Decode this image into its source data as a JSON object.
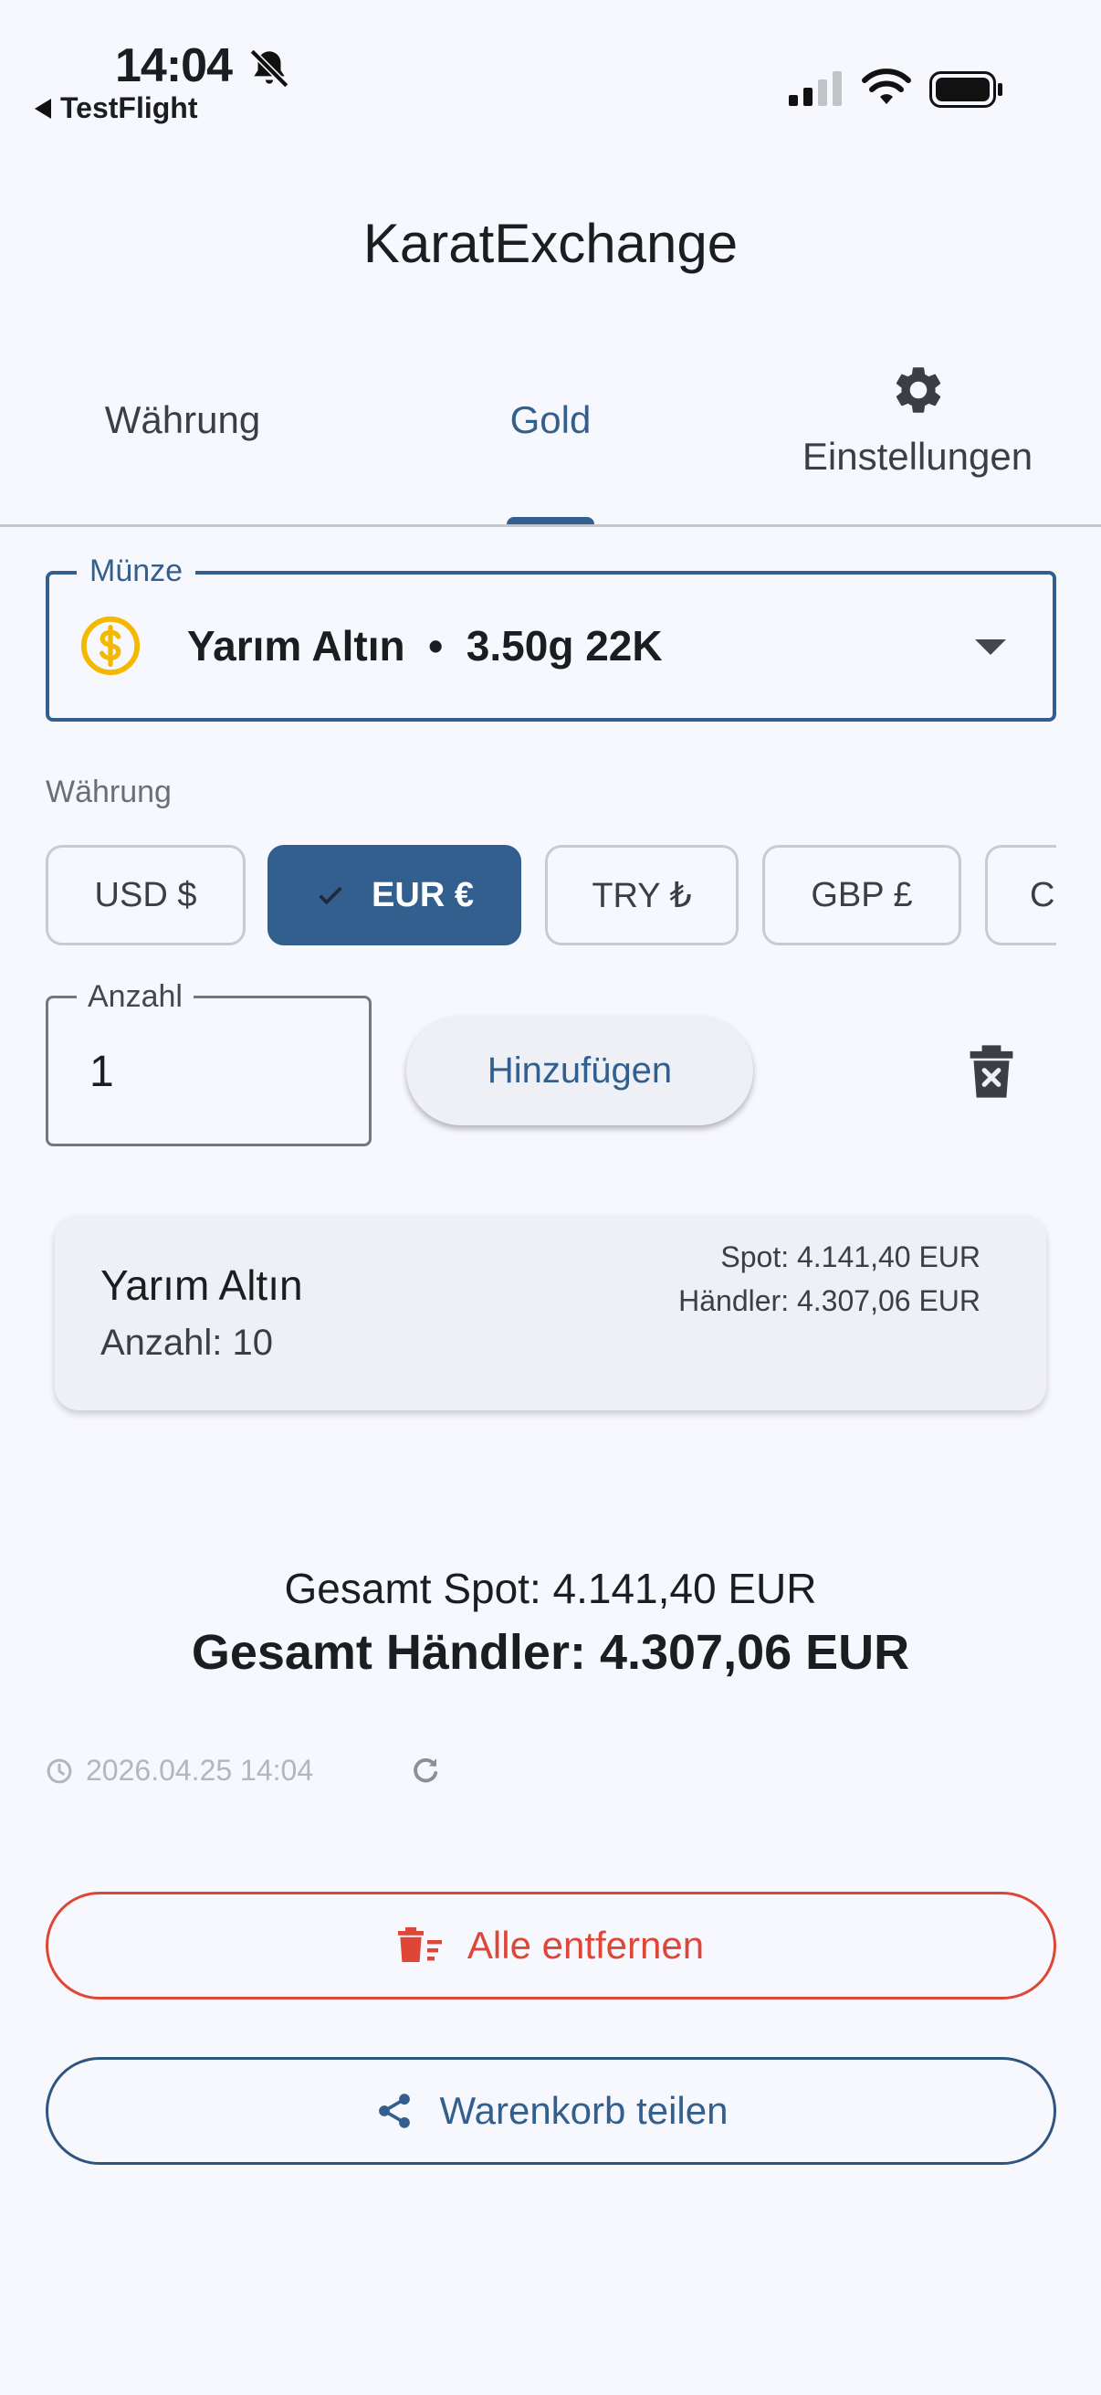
{
  "status": {
    "time": "14:04",
    "back_app": "TestFlight"
  },
  "app": {
    "title": "KaratExchange"
  },
  "tabs": [
    {
      "label": "Währung"
    },
    {
      "label": "Gold"
    },
    {
      "label": "Einstellungen"
    }
  ],
  "coin": {
    "legend": "Münze",
    "label": "Yarım Altın  •  3.50g 22K"
  },
  "currency": {
    "label": "Währung",
    "chips": [
      {
        "label": "USD $"
      },
      {
        "label": "EUR €"
      },
      {
        "label": "TRY ₺"
      },
      {
        "label": "GBP £"
      },
      {
        "label": "C"
      }
    ]
  },
  "quantity": {
    "legend": "Anzahl",
    "value": "1",
    "add_label": "Hinzufügen"
  },
  "cart_item": {
    "name": "Yarım Altın",
    "qty": "Anzahl: 10",
    "spot": "Spot: 4.141,40 EUR",
    "dealer": "Händler: 4.307,06 EUR"
  },
  "totals": {
    "spot": "Gesamt Spot: 4.141,40 EUR",
    "dealer": "Gesamt Händler: 4.307,06 EUR"
  },
  "timestamp": "2026.04.25 14:04",
  "actions": {
    "remove_all": "Alle entfernen",
    "share": "Warenkorb teilen"
  },
  "colors": {
    "primary": "#325f8e",
    "danger": "#de4637",
    "background": "#f7f8fd",
    "coin_gold": "#f5b800"
  }
}
